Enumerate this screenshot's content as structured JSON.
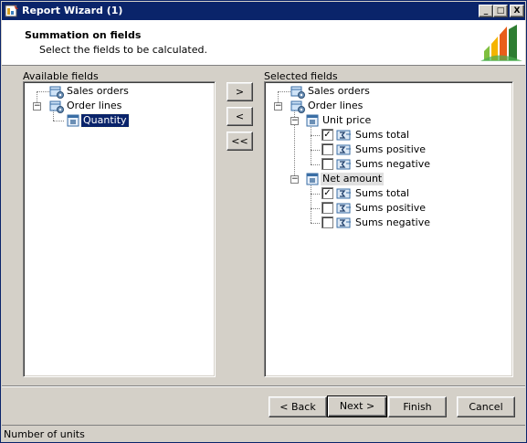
{
  "window": {
    "title": "Report Wizard (1)",
    "min_glyph": "_",
    "max_glyph": "□",
    "close_glyph": "X"
  },
  "header": {
    "title": "Summation on fields",
    "subtitle": "Select the fields to be calculated."
  },
  "available": {
    "label": "Available fields",
    "nodes": [
      {
        "label": "Sales orders",
        "icon": "table-gear-icon"
      },
      {
        "label": "Order lines",
        "icon": "table-gear-icon",
        "expander": "−"
      },
      {
        "label": "Quantity",
        "icon": "field-icon",
        "selected": true
      }
    ]
  },
  "move_buttons": {
    "add": ">",
    "remove": "<",
    "remove_all": "<<"
  },
  "selected": {
    "label": "Selected fields",
    "nodes": [
      {
        "label": "Sales orders",
        "icon": "table-gear-icon"
      },
      {
        "label": "Order lines",
        "icon": "table-gear-icon",
        "expander": "−"
      },
      {
        "label": "Unit price",
        "icon": "field-icon",
        "expander": "−"
      },
      {
        "label": "Sums total",
        "icon": "sum-icon",
        "checked": true
      },
      {
        "label": "Sums positive",
        "icon": "sum-icon",
        "checked": false
      },
      {
        "label": "Sums negative",
        "icon": "sum-icon",
        "checked": false
      },
      {
        "label": "Net amount",
        "icon": "field-icon",
        "expander": "−"
      },
      {
        "label": "Sums total",
        "icon": "sum-icon",
        "checked": true
      },
      {
        "label": "Sums positive",
        "icon": "sum-icon",
        "checked": false
      },
      {
        "label": "Sums negative",
        "icon": "sum-icon",
        "checked": false
      }
    ]
  },
  "footer": {
    "back": "< Back",
    "next": "Next >",
    "finish": "Finish",
    "cancel": "Cancel"
  },
  "status": {
    "text": "Number of units"
  },
  "colors": {
    "titlebar": "#0a246a",
    "selection": "#0a246a",
    "face": "#d4d0c8"
  }
}
